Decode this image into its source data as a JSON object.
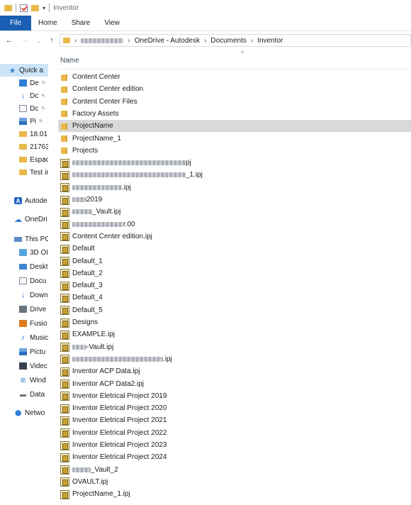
{
  "window": {
    "title": "Inventor"
  },
  "ribbon": {
    "tabs": [
      "File",
      "Home",
      "Share",
      "View"
    ]
  },
  "address": {
    "crumbs": [
      "OneDrive - Autodesk",
      "Documents",
      "Inventor"
    ]
  },
  "sidebar": {
    "items": [
      {
        "label": "Quick a",
        "icon": "star-icon",
        "pinned": false,
        "selected": true
      },
      {
        "label": "De",
        "icon": "desktop-icon",
        "pinned": true
      },
      {
        "label": "Dc",
        "icon": "downloads-icon",
        "pinned": true
      },
      {
        "label": "Dc",
        "icon": "document-icon",
        "pinned": true
      },
      {
        "label": "Pi",
        "icon": "pictures-icon",
        "pinned": true
      },
      {
        "label": "18.01",
        "icon": "folder-icon"
      },
      {
        "label": "21763",
        "icon": "folder-icon"
      },
      {
        "label": "Espac",
        "icon": "folder-icon"
      },
      {
        "label": "Test ir",
        "icon": "folder-icon"
      },
      {
        "label": "Autode",
        "icon": "autodesk-icon"
      },
      {
        "label": "OneDri",
        "icon": "onedrive-icon"
      },
      {
        "label": "This PC",
        "icon": "this-pc-icon"
      },
      {
        "label": "3D OI",
        "icon": "3d-objects-icon"
      },
      {
        "label": "Deskt",
        "icon": "desktop-icon"
      },
      {
        "label": "Docu",
        "icon": "document-icon"
      },
      {
        "label": "Down",
        "icon": "downloads-icon"
      },
      {
        "label": "Drive",
        "icon": "drive-icon"
      },
      {
        "label": "Fusio",
        "icon": "fusion-icon"
      },
      {
        "label": "Music",
        "icon": "music-icon"
      },
      {
        "label": "Pictu",
        "icon": "pictures-icon"
      },
      {
        "label": "Videc",
        "icon": "videos-icon"
      },
      {
        "label": "Wind",
        "icon": "windows-drive-icon"
      },
      {
        "label": "Data",
        "icon": "data-drive-icon"
      },
      {
        "label": "Netwo",
        "icon": "network-icon"
      }
    ]
  },
  "list": {
    "column_name": "Name",
    "files": [
      {
        "name": "Content Center",
        "type": "folder"
      },
      {
        "name": "Content Center edition",
        "type": "folder"
      },
      {
        "name": "Content Center Files",
        "type": "folder"
      },
      {
        "name": "Factory Assets",
        "type": "folder"
      },
      {
        "name": "ProjectName",
        "type": "folder",
        "selected": true
      },
      {
        "name": "ProjectName_1",
        "type": "folder"
      },
      {
        "name": "Projects",
        "type": "folder"
      },
      {
        "name": "pj",
        "type": "ipj",
        "redacted_prefix": true
      },
      {
        "name": "_1.ipj",
        "type": "ipj",
        "redacted_prefix": true
      },
      {
        "name": ".ipj",
        "type": "ipj",
        "redacted_prefix": true
      },
      {
        "name": "2019",
        "type": "ipj",
        "redacted_prefix": true
      },
      {
        "name": "_Vault.ipj",
        "type": "ipj",
        "redacted_prefix": true
      },
      {
        "name": "r.00",
        "type": "ipj",
        "redacted_prefix": true
      },
      {
        "name": "Content Center edition.ipj",
        "type": "ipj"
      },
      {
        "name": "Default",
        "type": "ipj"
      },
      {
        "name": "Default_1",
        "type": "ipj"
      },
      {
        "name": "Default_2",
        "type": "ipj"
      },
      {
        "name": "Default_3",
        "type": "ipj"
      },
      {
        "name": "Default_4",
        "type": "ipj"
      },
      {
        "name": "Default_5",
        "type": "ipj"
      },
      {
        "name": "Designs",
        "type": "ipj"
      },
      {
        "name": "EXAMPLE.ipj",
        "type": "ipj"
      },
      {
        "name": "-Vault.ipj",
        "type": "ipj",
        "redacted_prefix": true
      },
      {
        "name": ".ipj",
        "type": "ipj",
        "redacted_prefix": true
      },
      {
        "name": "Inventor ACP Data.ipj",
        "type": "ipj"
      },
      {
        "name": "Inventor ACP Data2.ipj",
        "type": "ipj"
      },
      {
        "name": "Inventor Eletrical Project 2019",
        "type": "ipj"
      },
      {
        "name": "Inventor Eletrical Project 2020",
        "type": "ipj"
      },
      {
        "name": "Inventor Eletrical Project 2021",
        "type": "ipj"
      },
      {
        "name": "Inventor Eletrical Project 2022",
        "type": "ipj"
      },
      {
        "name": "Inventor Eletrical Project 2023",
        "type": "ipj"
      },
      {
        "name": "Inventor Eletrical Project 2024",
        "type": "ipj"
      },
      {
        "name": "_Vault_2",
        "type": "ipj",
        "redacted_prefix": true
      },
      {
        "name": "OVAULT.ipj",
        "type": "ipj"
      },
      {
        "name": "ProjectName_1.ipj",
        "type": "ipj"
      }
    ]
  },
  "colors": {
    "file_tab": "#1a5fb4",
    "folder": "#e9b94c",
    "selected_row": "#d9d9d9",
    "sidebar_selected": "#cce4f7"
  }
}
